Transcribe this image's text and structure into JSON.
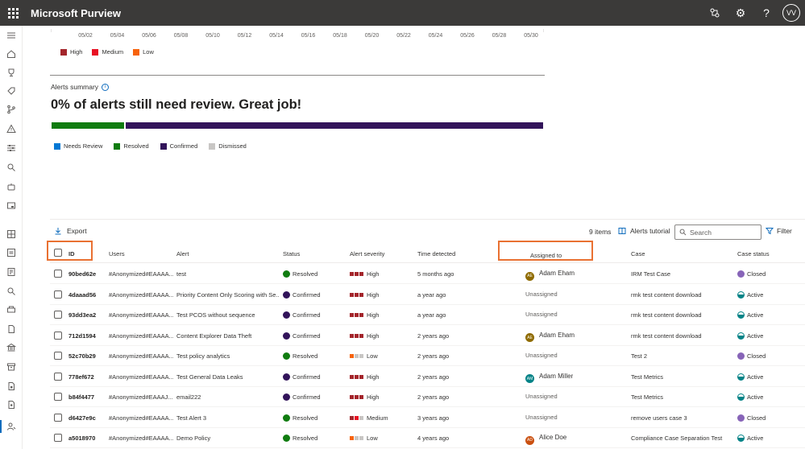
{
  "app": {
    "title": "Microsoft Purview",
    "avatar_initials": "VV"
  },
  "timeline": {
    "dates": [
      "05/02",
      "05/04",
      "05/06",
      "05/08",
      "05/10",
      "05/12",
      "05/14",
      "05/16",
      "05/18",
      "05/20",
      "05/22",
      "05/24",
      "05/26",
      "05/28",
      "05/30"
    ]
  },
  "severity_legend": [
    {
      "label": "High",
      "color": "#a4262c"
    },
    {
      "label": "Medium",
      "color": "#e81123"
    },
    {
      "label": "Low",
      "color": "#f7630c"
    }
  ],
  "summary": {
    "label": "Alerts summary",
    "headline": "0% of alerts still need review. Great job!",
    "bar": [
      {
        "status": "Needs Review",
        "fraction": 0.0,
        "color": "#0078d4"
      },
      {
        "status": "Resolved",
        "fraction": 0.15,
        "color": "#107c10"
      },
      {
        "status": "Confirmed",
        "fraction": 0.85,
        "color": "#32145a"
      },
      {
        "status": "Dismissed",
        "fraction": 0.0,
        "color": "#c8c6c4"
      }
    ]
  },
  "toolbar": {
    "export_label": "Export",
    "items_count": "9 items",
    "tutorial_label": "Alerts tutorial",
    "search_placeholder": "Search",
    "filter_label": "Filter"
  },
  "table": {
    "headers": {
      "id": "ID",
      "users": "Users",
      "alert": "Alert",
      "status": "Status",
      "severity": "Alert severity",
      "time": "Time detected",
      "assigned": "Assigned to",
      "case": "Case",
      "case_status": "Case status"
    },
    "rows": [
      {
        "id": "90bed62e",
        "users": "#Anonymized#EAAAA...",
        "alert": "test",
        "status": "Resolved",
        "severity": "High",
        "time": "5 months ago",
        "assigned": "Adam Eham",
        "assigned_initials": "AE",
        "case": "IRM Test Case",
        "case_status": "Closed"
      },
      {
        "id": "4daaad56",
        "users": "#Anonymized#EAAAA...",
        "alert": "Priority Content Only Scoring with Se...",
        "status": "Confirmed",
        "severity": "High",
        "time": "a year ago",
        "assigned": "Unassigned",
        "assigned_initials": "",
        "case": "rmk test content download",
        "case_status": "Active"
      },
      {
        "id": "93dd3ea2",
        "users": "#Anonymized#EAAAA...",
        "alert": "Test PCOS without sequence",
        "status": "Confirmed",
        "severity": "High",
        "time": "a year ago",
        "assigned": "Unassigned",
        "assigned_initials": "",
        "case": "rmk test content download",
        "case_status": "Active"
      },
      {
        "id": "712d1594",
        "users": "#Anonymized#EAAAA...",
        "alert": "Content Explorer Data Theft",
        "status": "Confirmed",
        "severity": "High",
        "time": "2 years ago",
        "assigned": "Adam Eham",
        "assigned_initials": "AE",
        "case": "rmk test content download",
        "case_status": "Active"
      },
      {
        "id": "52c70b29",
        "users": "#Anonymized#EAAAA...",
        "alert": "Test policy analytics",
        "status": "Resolved",
        "severity": "Low",
        "time": "2 years ago",
        "assigned": "Unassigned",
        "assigned_initials": "",
        "case": "Test 2",
        "case_status": "Closed"
      },
      {
        "id": "778ef672",
        "users": "#Anonymized#EAAAA...",
        "alert": "Test General Data Leaks",
        "status": "Confirmed",
        "severity": "High",
        "time": "2 years ago",
        "assigned": "Adam Miller",
        "assigned_initials": "AM",
        "case": "Test Metrics",
        "case_status": "Active"
      },
      {
        "id": "b84f4477",
        "users": "#Anonymized#EAAAJ...",
        "alert": "email222",
        "status": "Confirmed",
        "severity": "High",
        "time": "2 years ago",
        "assigned": "Unassigned",
        "assigned_initials": "",
        "case": "Test Metrics",
        "case_status": "Active"
      },
      {
        "id": "d6427e9c",
        "users": "#Anonymized#EAAAA...",
        "alert": "Test Alert 3",
        "status": "Resolved",
        "severity": "Medium",
        "time": "3 years ago",
        "assigned": "Unassigned",
        "assigned_initials": "",
        "case": "remove users case 3",
        "case_status": "Closed"
      },
      {
        "id": "a5018970",
        "users": "#Anonymized#EAAAA...",
        "alert": "Demo Policy",
        "status": "Resolved",
        "severity": "Low",
        "time": "4 years ago",
        "assigned": "Alice Doe",
        "assigned_initials": "AD",
        "case": "Compliance Case Separation Test",
        "case_status": "Active"
      }
    ]
  },
  "colors": {
    "resolved": "#107c10",
    "confirmed": "#32145a",
    "closed": "#8764b8",
    "active": "#038387",
    "high": "#a4262c",
    "medium": "#e81123",
    "low": "#f7630c",
    "highlight": "#e97132"
  },
  "icons": {
    "rail": [
      "hamburger-icon",
      "home-icon",
      "trophy-icon",
      "tag-icon",
      "branch-icon",
      "warning-icon",
      "settings-sliders-icon",
      "search-magnifier-icon",
      "bot-icon",
      "device-icon",
      "dashboard-icon",
      "report-icon",
      "policy-icon",
      "explore-icon",
      "print-icon",
      "document-icon",
      "bank-icon",
      "archive-icon",
      "file-lock-icon",
      "file-person-icon",
      "insider-risk-icon"
    ]
  }
}
